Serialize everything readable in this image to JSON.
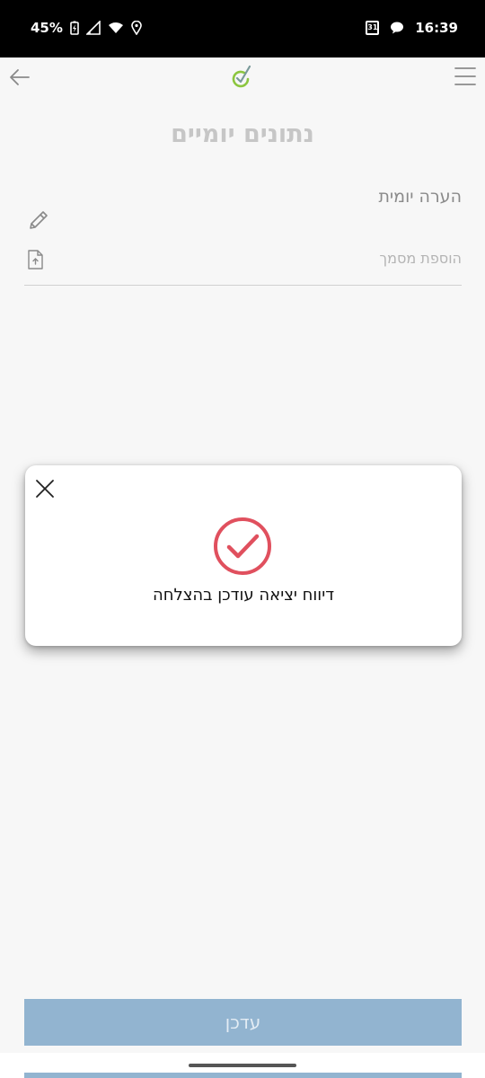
{
  "status_bar": {
    "battery": "45%",
    "time": "16:39",
    "calendar_day": "31"
  },
  "header": {
    "title": "נתונים יומיים"
  },
  "form": {
    "daily_note_label": "הערה יומית",
    "add_document_label": "הוספת מסמך"
  },
  "dialog": {
    "message": "דיווח יציאה עודכן בהצלחה"
  },
  "footer": {
    "update_button_label": "עדכן"
  },
  "colors": {
    "success": "#e0505e",
    "button": "#92b4d0",
    "logo_green": "#8cc63f"
  }
}
